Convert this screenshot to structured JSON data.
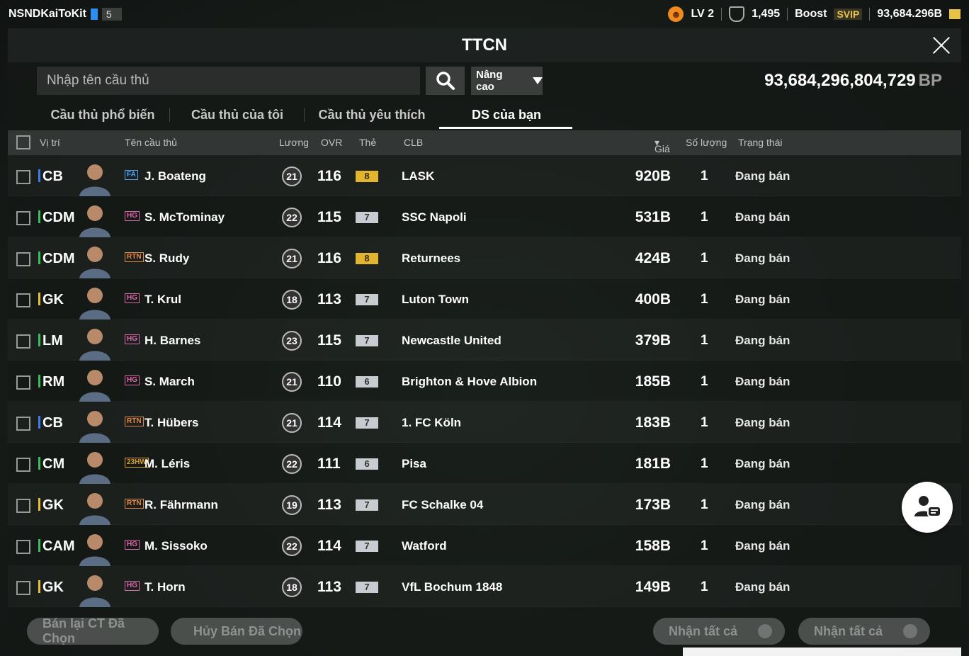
{
  "topbar": {
    "username": "NSNDKaiToKit",
    "flag_number": "5",
    "level": "LV 2",
    "trophies": "1,495",
    "boost_label": "Boost",
    "svip_label": "SVIP",
    "balance": "93,684.296B"
  },
  "panel": {
    "title": "TTCN",
    "search_placeholder": "Nhập tên cầu thủ",
    "advanced_label": "Nâng cao",
    "bp_value": "93,684,296,804,729",
    "bp_unit": "BP"
  },
  "tabs": [
    {
      "label": "Cầu thủ phổ biến"
    },
    {
      "label": "Cầu thủ của tôi"
    },
    {
      "label": "Cầu thủ yêu thích"
    },
    {
      "label": "DS của bạn"
    }
  ],
  "table_header": {
    "position": "Vị trí",
    "name": "Tên cầu thủ",
    "salary": "Lương",
    "ovr": "OVR",
    "card": "Thẻ",
    "club": "CLB",
    "price": "Giá",
    "quantity": "Số lượng",
    "status": "Trạng thái"
  },
  "rows": [
    {
      "pos": "CB",
      "pos_color": "#3d7cf0",
      "season": "FA",
      "season_color": "#4da3ff",
      "name": "J. Boateng",
      "salary": "21",
      "ovr": "116",
      "card": "8",
      "card_tier": "gold",
      "club": "LASK",
      "price": "920B",
      "qty": "1",
      "status": "Đang bán"
    },
    {
      "pos": "CDM",
      "pos_color": "#35c05a",
      "season": "HG",
      "season_color": "#d86aa8",
      "name": "S. McTominay",
      "salary": "22",
      "ovr": "115",
      "card": "7",
      "card_tier": "silver",
      "club": "SSC Napoli",
      "price": "531B",
      "qty": "1",
      "status": "Đang bán"
    },
    {
      "pos": "CDM",
      "pos_color": "#35c05a",
      "season": "RTN",
      "season_color": "#e0884a",
      "name": "S. Rudy",
      "salary": "21",
      "ovr": "116",
      "card": "8",
      "card_tier": "gold",
      "club": "Returnees",
      "price": "424B",
      "qty": "1",
      "status": "Đang bán"
    },
    {
      "pos": "GK",
      "pos_color": "#e8c030",
      "season": "HG",
      "season_color": "#d86aa8",
      "name": "T. Krul",
      "salary": "18",
      "ovr": "113",
      "card": "7",
      "card_tier": "silver",
      "club": "Luton Town",
      "price": "400B",
      "qty": "1",
      "status": "Đang bán"
    },
    {
      "pos": "LM",
      "pos_color": "#35c05a",
      "season": "HG",
      "season_color": "#d86aa8",
      "name": "H. Barnes",
      "salary": "23",
      "ovr": "115",
      "card": "7",
      "card_tier": "silver",
      "club": "Newcastle United",
      "price": "379B",
      "qty": "1",
      "status": "Đang bán"
    },
    {
      "pos": "RM",
      "pos_color": "#35c05a",
      "season": "HG",
      "season_color": "#d86aa8",
      "name": "S. March",
      "salary": "21",
      "ovr": "110",
      "card": "6",
      "card_tier": "silver",
      "club": "Brighton & Hove Albion",
      "price": "185B",
      "qty": "1",
      "status": "Đang bán"
    },
    {
      "pos": "CB",
      "pos_color": "#3d7cf0",
      "season": "RTN",
      "season_color": "#e0884a",
      "name": "T. Hübers",
      "salary": "21",
      "ovr": "114",
      "card": "7",
      "card_tier": "silver",
      "club": "1. FC Köln",
      "price": "183B",
      "qty": "1",
      "status": "Đang bán"
    },
    {
      "pos": "CM",
      "pos_color": "#35c05a",
      "season": "23HW",
      "season_color": "#d8a030",
      "name": "M. Léris",
      "salary": "22",
      "ovr": "111",
      "card": "6",
      "card_tier": "silver",
      "club": "Pisa",
      "price": "181B",
      "qty": "1",
      "status": "Đang bán"
    },
    {
      "pos": "GK",
      "pos_color": "#e8c030",
      "season": "RTN",
      "season_color": "#e0884a",
      "name": "R. Fährmann",
      "salary": "19",
      "ovr": "113",
      "card": "7",
      "card_tier": "silver",
      "club": "FC Schalke 04",
      "price": "173B",
      "qty": "1",
      "status": "Đang bán"
    },
    {
      "pos": "CAM",
      "pos_color": "#35c05a",
      "season": "HG",
      "season_color": "#d86aa8",
      "name": "M. Sissoko",
      "salary": "22",
      "ovr": "114",
      "card": "7",
      "card_tier": "silver",
      "club": "Watford",
      "price": "158B",
      "qty": "1",
      "status": "Đang bán"
    },
    {
      "pos": "GK",
      "pos_color": "#e8c030",
      "season": "HG",
      "season_color": "#d86aa8",
      "name": "T. Horn",
      "salary": "18",
      "ovr": "113",
      "card": "7",
      "card_tier": "silver",
      "club": "VfL Bochum 1848",
      "price": "149B",
      "qty": "1",
      "status": "Đang bán"
    }
  ],
  "bottom": {
    "resell_selected": "Bán lại CT Đã Chọn",
    "cancel_selected": "Hủy Bán Đã Chọn",
    "collect_all_1": "Nhận tất cả",
    "collect_all_2": "Nhận tất cả"
  }
}
